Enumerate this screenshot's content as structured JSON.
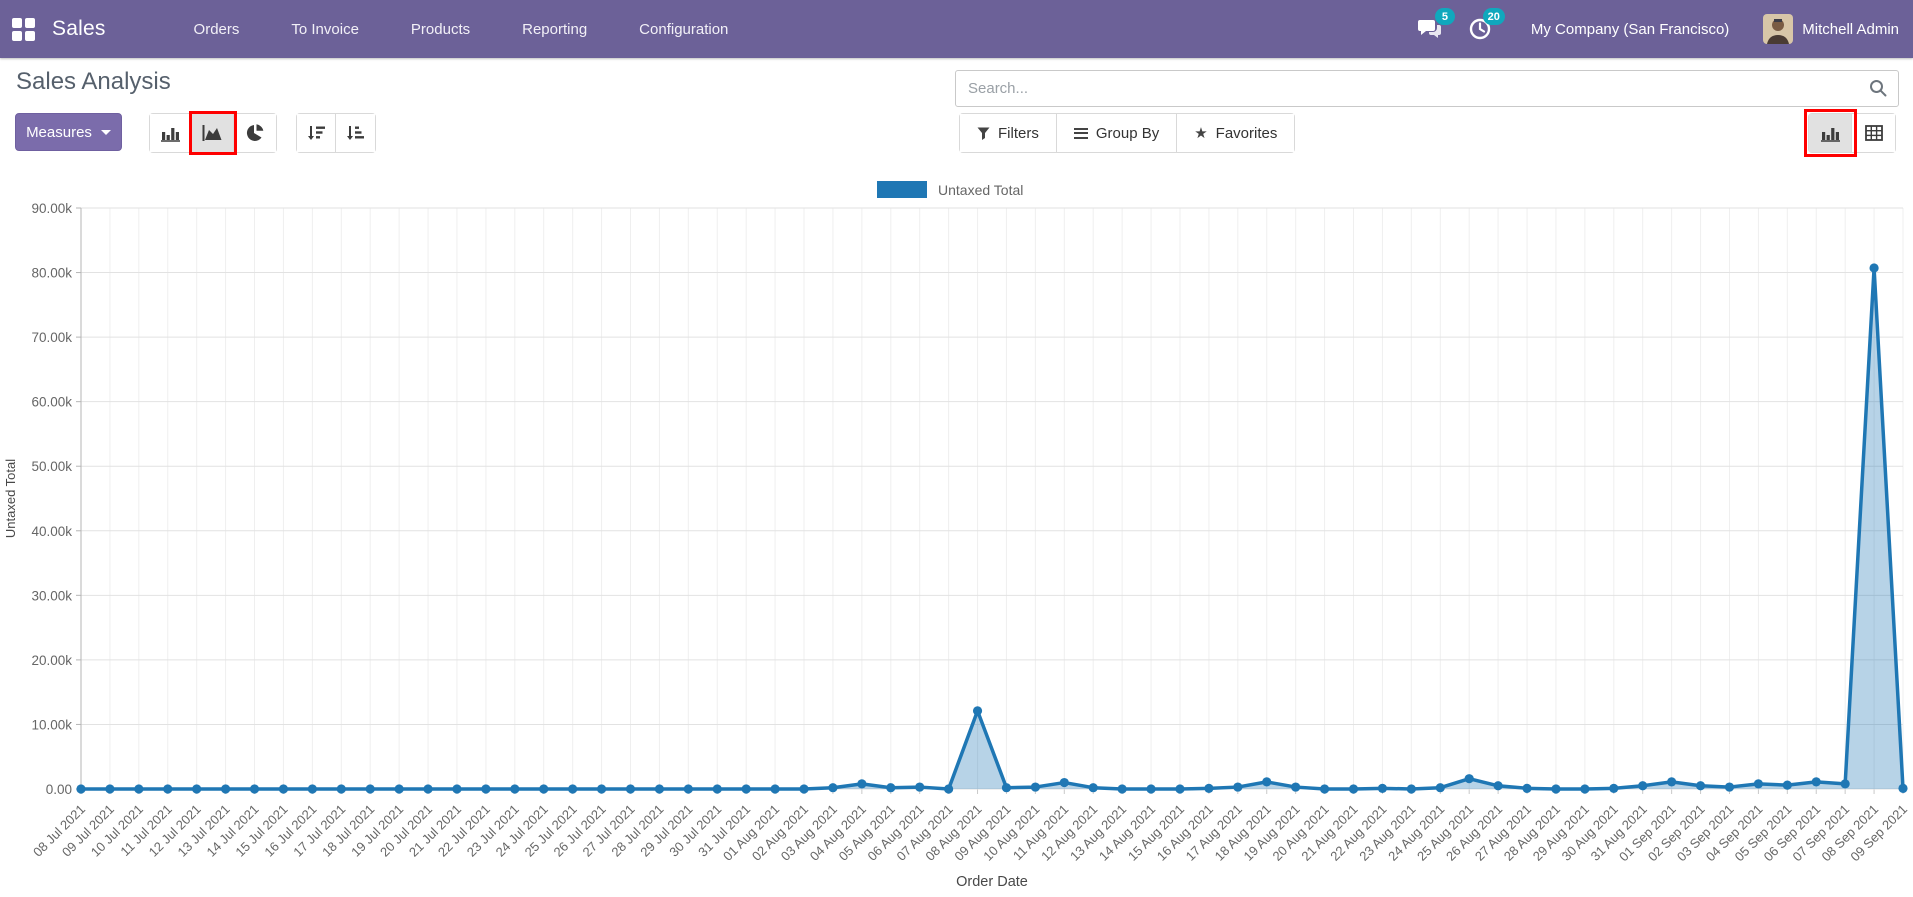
{
  "nav": {
    "app_name": "Sales",
    "menus": [
      "Orders",
      "To Invoice",
      "Products",
      "Reporting",
      "Configuration"
    ],
    "messages_badge": "5",
    "activities_badge": "20",
    "company": "My Company (San Francisco)",
    "user": "Mitchell Admin"
  },
  "header": {
    "title": "Sales Analysis",
    "measures_label": "Measures",
    "search_placeholder": "Search...",
    "filters_label": "Filters",
    "group_by_label": "Group By",
    "favorites_label": "Favorites"
  },
  "icons": {
    "apps": "apps-grid",
    "messages": "chat-bubbles",
    "activities": "clock",
    "search": "magnifier",
    "measures_caret": "caret-down",
    "chart_bar": "bar-chart",
    "chart_line": "area-chart",
    "chart_pie": "pie-chart",
    "sort_desc": "sort-amount-desc",
    "sort_asc": "sort-amount-asc",
    "filters": "funnel",
    "group_by": "hamburger",
    "favorites": "star",
    "view_graph": "bar-chart",
    "view_pivot": "pivot-table"
  },
  "colors": {
    "navbar": "#6c6198",
    "measures_button": "#7b6cab",
    "badge": "#10a8bd",
    "series_line": "#1f77b4",
    "series_fill": "rgba(31,119,180,0.32)",
    "highlight_red": "#fe0000",
    "title_text": "#56606c",
    "tick_text": "#666666"
  },
  "annotations": {
    "highlighted_buttons": [
      "line-chart-type-button",
      "graph-view-button"
    ]
  },
  "chart_data": {
    "type": "area",
    "xlabel": "Order Date",
    "ylabel": "Untaxed Total",
    "ylim": [
      0,
      90000
    ],
    "grid": true,
    "legend_position": "top",
    "y_ticks": [
      "0.00",
      "10.00k",
      "20.00k",
      "30.00k",
      "40.00k",
      "50.00k",
      "60.00k",
      "70.00k",
      "80.00k",
      "90.00k"
    ],
    "x": [
      "08 Jul 2021",
      "09 Jul 2021",
      "10 Jul 2021",
      "11 Jul 2021",
      "12 Jul 2021",
      "13 Jul 2021",
      "14 Jul 2021",
      "15 Jul 2021",
      "16 Jul 2021",
      "17 Jul 2021",
      "18 Jul 2021",
      "19 Jul 2021",
      "20 Jul 2021",
      "21 Jul 2021",
      "22 Jul 2021",
      "23 Jul 2021",
      "24 Jul 2021",
      "25 Jul 2021",
      "26 Jul 2021",
      "27 Jul 2021",
      "28 Jul 2021",
      "29 Jul 2021",
      "30 Jul 2021",
      "31 Jul 2021",
      "01 Aug 2021",
      "02 Aug 2021",
      "03 Aug 2021",
      "04 Aug 2021",
      "05 Aug 2021",
      "06 Aug 2021",
      "07 Aug 2021",
      "08 Aug 2021",
      "09 Aug 2021",
      "10 Aug 2021",
      "11 Aug 2021",
      "12 Aug 2021",
      "13 Aug 2021",
      "14 Aug 2021",
      "15 Aug 2021",
      "16 Aug 2021",
      "17 Aug 2021",
      "18 Aug 2021",
      "19 Aug 2021",
      "20 Aug 2021",
      "21 Aug 2021",
      "22 Aug 2021",
      "23 Aug 2021",
      "24 Aug 2021",
      "25 Aug 2021",
      "26 Aug 2021",
      "27 Aug 2021",
      "28 Aug 2021",
      "29 Aug 2021",
      "30 Aug 2021",
      "31 Aug 2021",
      "01 Sep 2021",
      "02 Sep 2021",
      "03 Sep 2021",
      "04 Sep 2021",
      "05 Sep 2021",
      "06 Sep 2021",
      "07 Sep 2021",
      "08 Sep 2021",
      "09 Sep 2021"
    ],
    "series": [
      {
        "name": "Untaxed Total",
        "values": [
          0,
          0,
          0,
          0,
          0,
          0,
          0,
          0,
          0,
          0,
          0,
          0,
          0,
          0,
          0,
          0,
          0,
          0,
          0,
          0,
          0,
          0,
          0,
          0,
          0,
          0,
          200,
          800,
          200,
          300,
          0,
          12100,
          200,
          300,
          1000,
          200,
          0,
          0,
          0,
          100,
          300,
          1100,
          300,
          0,
          0,
          100,
          0,
          200,
          1600,
          500,
          100,
          0,
          0,
          100,
          500,
          1100,
          500,
          300,
          800,
          600,
          1100,
          800,
          80700,
          100
        ]
      }
    ]
  }
}
